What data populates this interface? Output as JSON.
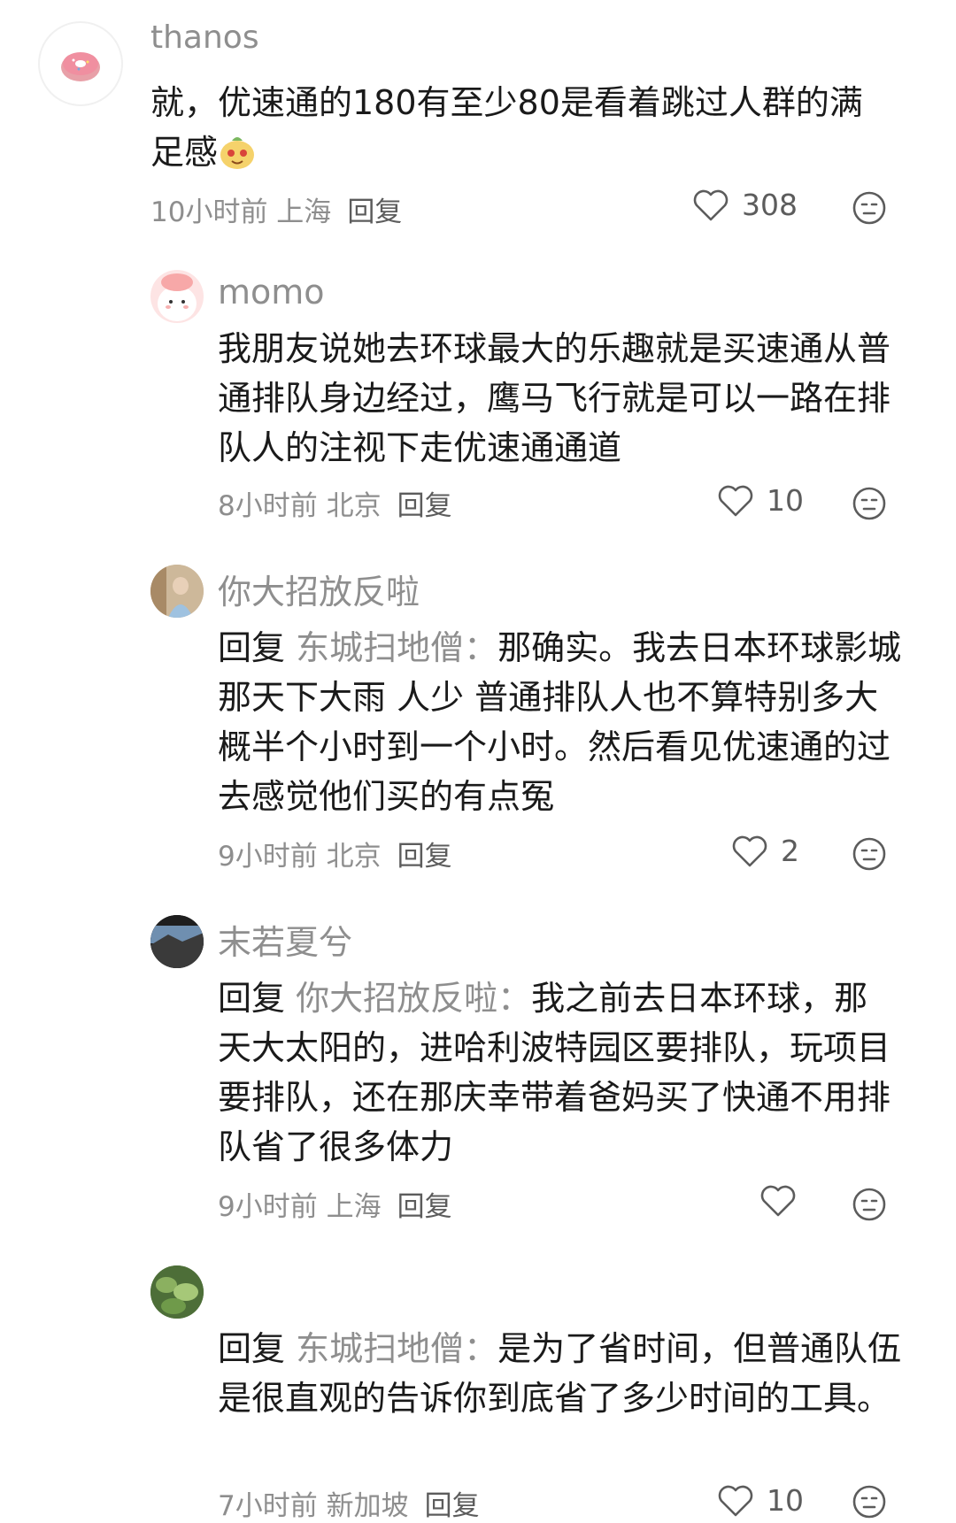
{
  "comments": [
    {
      "username": "thanos",
      "text": "就，优速通的180有至少80是看着跳过人群的满足感",
      "emoji": "smiling-face-emoji",
      "time_location": "10小时前 上海",
      "reply_label": "回复",
      "likes": "308",
      "avatar": "donut-avatar"
    },
    {
      "username": "momo",
      "text": "我朋友说她去环球最大的乐趣就是买速通从普通排队身边经过，鹰马飞行就是可以一路在排队人的注视下走优速通通道",
      "time_location": "8小时前 北京",
      "reply_label": "回复",
      "likes": "10",
      "avatar": "pink-cartoon-avatar"
    },
    {
      "username": "你大招放反啦",
      "reply_prefix": "回复",
      "reply_target": "东城扫地僧：",
      "text": "那确实。我去日本环球影城那天下大雨 人少 普通排队人也不算特别多大概半个小时到一个小时。然后看见优速通的过去感觉他们买的有点冤",
      "time_location": "9小时前 北京",
      "reply_label": "回复",
      "likes": "2",
      "avatar": "photo-avatar"
    },
    {
      "username": "末若夏兮",
      "reply_prefix": "回复",
      "reply_target": "你大招放反啦：",
      "text": "我之前去日本环球，那天大太阳的，进哈利波特园区要排队，玩项目要排队，还在那庆幸带着爸妈买了快通不用排队省了很多体力",
      "time_location": "9小时前 上海",
      "reply_label": "回复",
      "likes": "",
      "avatar": "landscape-avatar"
    },
    {
      "username": "",
      "reply_prefix": "回复",
      "reply_target": "东城扫地僧：",
      "text": "是为了省时间，但普通队伍是很直观的告诉你到底省了多少时间的工具。",
      "time_location": "7小时前 新加坡",
      "reply_label": "回复",
      "likes": "10",
      "avatar": "plant-avatar"
    }
  ],
  "colors": {
    "text": "#1a1a1a",
    "secondary": "#8e8e8e",
    "icon": "#5c5c5c",
    "background": "#ffffff"
  }
}
